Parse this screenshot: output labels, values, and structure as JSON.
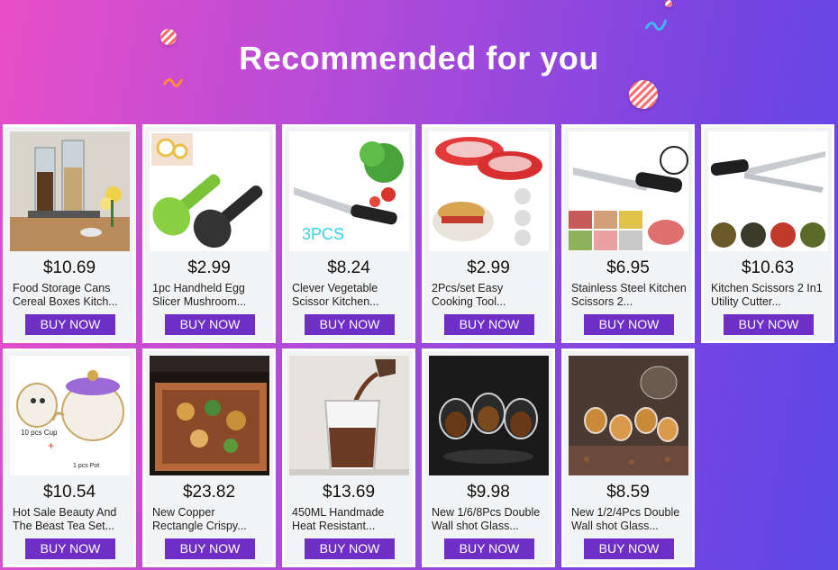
{
  "banner": {
    "title": "Recommended for you"
  },
  "colors": {
    "button": "#6f2fc7",
    "card_bg": "#f2f3f5"
  },
  "products": [
    {
      "price": "$10.69",
      "name": "Food Storage Cans Cereal Boxes Kitch...",
      "button": "BUY NOW",
      "image": "food-storage-jars"
    },
    {
      "price": "$2.99",
      "name": "1pc Handheld Egg Slicer Mushroom...",
      "button": "BUY NOW",
      "image": "egg-slicer"
    },
    {
      "price": "$8.24",
      "name": "Clever Vegetable Scissor Kitchen...",
      "button": "BUY NOW",
      "image": "vegetable-scissor",
      "image_label": "3PCS"
    },
    {
      "price": "$2.99",
      "name": "2Pcs/set Easy Cooking Tool...",
      "button": "BUY NOW",
      "image": "egg-cooker"
    },
    {
      "price": "$6.95",
      "name": "Stainless Steel Kitchen Scissors 2...",
      "button": "BUY NOW",
      "image": "steel-scissors"
    },
    {
      "price": "$10.63",
      "name": "Kitchen Scissors 2 In1 Utility Cutter...",
      "button": "BUY NOW",
      "image": "utility-cutter"
    },
    {
      "price": "$10.54",
      "name": "Hot Sale Beauty And The Beast Tea Set...",
      "button": "BUY NOW",
      "image": "tea-set",
      "image_label": "10 pcs Cup",
      "image_label_2": "1 pcs Pot"
    },
    {
      "price": "$23.82",
      "name": "New Copper Rectangle Crispy...",
      "button": "BUY NOW",
      "image": "copper-tray"
    },
    {
      "price": "$13.69",
      "name": "450ML Handmade Heat Resistant...",
      "button": "BUY NOW",
      "image": "glass-cup"
    },
    {
      "price": "$9.98",
      "name": "New 1/6/8Pcs Double Wall shot Glass...",
      "button": "BUY NOW",
      "image": "shot-glasses"
    },
    {
      "price": "$8.59",
      "name": "New 1/2/4Pcs Double Wall shot Glass...",
      "button": "BUY NOW",
      "image": "tea-glasses"
    }
  ]
}
